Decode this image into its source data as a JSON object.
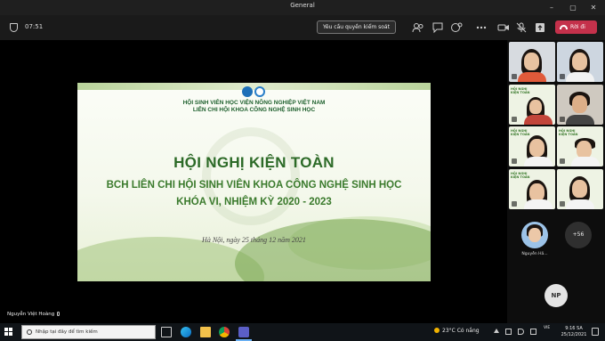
{
  "window": {
    "title": "General"
  },
  "toolbar": {
    "timer": "07:51",
    "request_control_label": "Yêu cầu quyền kiểm soát",
    "leave_label": "Rời đi"
  },
  "slide": {
    "org_line1": "HỘI SINH VIÊN HỌC VIỆN NÔNG NGHIỆP VIỆT NAM",
    "org_line2": "LIÊN CHI HỘI KHOA CÔNG NGHỆ SINH HỌC",
    "heading": "HỘI NGHỊ KIỆN TOÀN",
    "subtitle1": "BCH LIÊN CHI HỘI SINH VIÊN KHOA CÔNG NGHỆ SINH HỌC",
    "subtitle2": "KHÓA VI, NHIỆM KỲ 2020 - 2023",
    "date": "Hà Nội, ngày 25 tháng 12 năm 2021"
  },
  "presenter_name": "Nguyễn Việt Hoàng",
  "gallery": {
    "tile_caption": "HỘI NGHỊ KIỆN TOÀN",
    "avatar_name": "Nguyễn Hả...",
    "more_count": "+56",
    "initials": "NP"
  },
  "taskbar": {
    "search_placeholder": "Nhập tại đây để tìm kiếm",
    "weather": "23°C  Có nắng",
    "lang": "VIE",
    "time": "9:16 SA",
    "date": "25/12/2021"
  },
  "colors": {
    "leave": "#c4314b",
    "slide_green": "#2c6a27",
    "taskbar": "#101418"
  }
}
